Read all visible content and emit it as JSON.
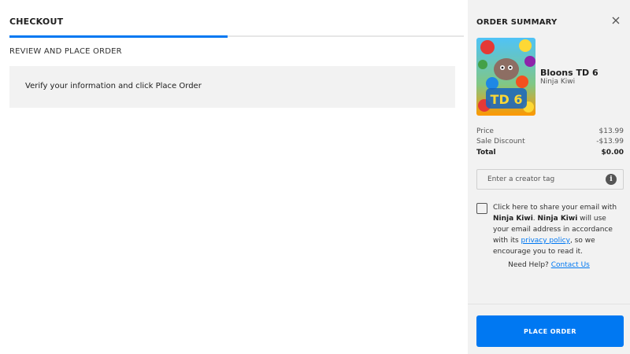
{
  "main": {
    "title": "CHECKOUT",
    "progress_fraction": 0.48,
    "section_title": "REVIEW AND PLACE ORDER",
    "info_message": "Verify your information and click Place Order"
  },
  "summary": {
    "title": "ORDER SUMMARY",
    "close_icon": "close-icon",
    "product": {
      "title": "Bloons TD 6",
      "developer": "Ninja Kiwi"
    },
    "price_label": "Price",
    "price_value": "$13.99",
    "discount_label": "Sale Discount",
    "discount_value": "-$13.99",
    "total_label": "Total",
    "total_value": "$0.00",
    "creator_placeholder": "Enter a creator tag",
    "info_icon_glyph": "i",
    "consent": {
      "part1": "Click here to share your email with ",
      "publisher1": "Ninja Kiwi",
      "part2": ". ",
      "publisher2": "Ninja Kiwi",
      "part3": " will use your email address in accordance with its ",
      "policy_link": "privacy policy",
      "part4": ", so we encourage you to read it."
    },
    "help_text": "Need Help? ",
    "help_link": "Contact Us",
    "place_order_label": "PLACE ORDER"
  },
  "colors": {
    "accent": "#0078f2",
    "panel_bg": "#f2f2f2"
  }
}
